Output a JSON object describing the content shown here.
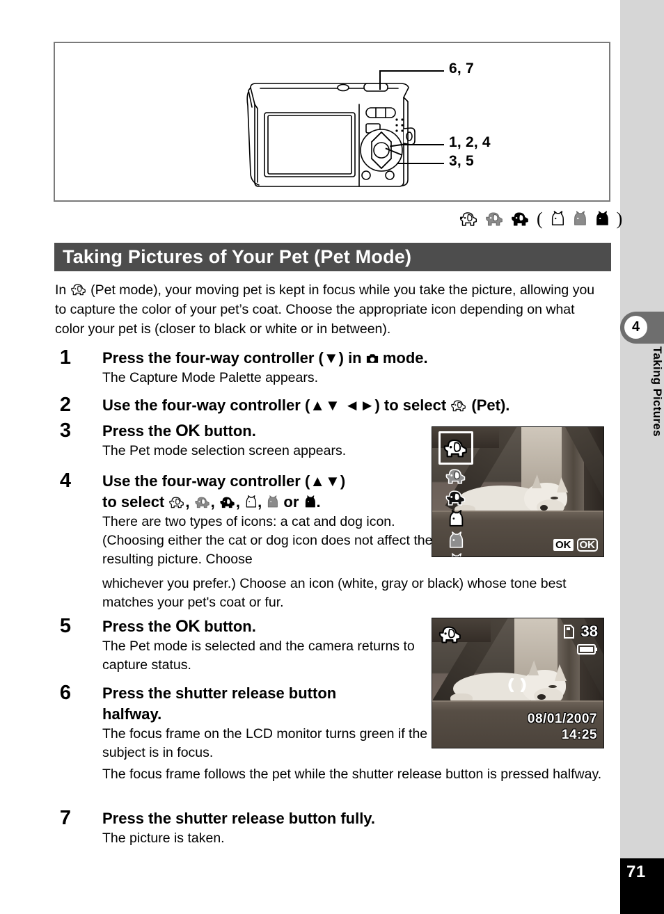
{
  "sidebar": {
    "chapter_number": "4",
    "chapter_title": "Taking Pictures",
    "page_number": "71"
  },
  "figure": {
    "callouts": [
      {
        "id": "callout-67",
        "label": "6, 7"
      },
      {
        "id": "callout-124",
        "label": "1, 2, 4"
      },
      {
        "id": "callout-35",
        "label": "3, 5"
      }
    ],
    "pet_icons": [
      {
        "name": "dog-white-icon",
        "tone": "white"
      },
      {
        "name": "dog-gray-icon",
        "tone": "gray"
      },
      {
        "name": "dog-black-icon",
        "tone": "black"
      },
      {
        "name": "paren-open",
        "tone": "text",
        "label": "("
      },
      {
        "name": "cat-white-icon",
        "tone": "white"
      },
      {
        "name": "cat-gray-icon",
        "tone": "gray"
      },
      {
        "name": "cat-black-icon",
        "tone": "black"
      },
      {
        "name": "paren-close",
        "tone": "text",
        "label": ")"
      }
    ],
    "paren_open": "(",
    "paren_close": ")"
  },
  "section": {
    "title": "Taking Pictures of Your Pet (Pet Mode)"
  },
  "intro": {
    "before_icon": "In ",
    "after_icon": " (Pet mode), your moving pet is kept in focus while you take the picture, allowing you to capture the color of your pet’s coat. Choose the appropriate icon depending on what color your pet is (closer to black or white or in between)."
  },
  "steps": [
    {
      "number": "1",
      "head_a": "Press the four-way controller (▼) in ",
      "head_b": " mode.",
      "body": "The Capture Mode Palette appears."
    },
    {
      "number": "2",
      "head_a": "Use the four-way controller (▲▼ ◄►) to select ",
      "head_b": " (Pet).",
      "body": ""
    },
    {
      "number": "3",
      "head_a": "Press the ",
      "head_ok": "OK",
      "head_b": " button.",
      "body": "The Pet mode selection screen appears."
    },
    {
      "number": "4",
      "head_a": "Use the four-way controller (▲▼)",
      "head_line2_a": "to select ",
      "head_sep": ", ",
      "head_or": " or ",
      "head_end": ".",
      "body": "There are two types of icons: a cat and dog icon. (Choosing either the cat or dog icon does not affect the resulting picture. Choose",
      "body_extra": "whichever you prefer.) Choose an icon (white, gray or black) whose tone best matches your pet's coat or fur."
    },
    {
      "number": "5",
      "head_a": "Press the ",
      "head_ok": "OK",
      "head_b": " button.",
      "body": "The Pet mode is selected and the camera returns to capture status."
    },
    {
      "number": "6",
      "head_a": "Press the shutter release button",
      "head_line2": "halfway.",
      "body": "The focus frame on the LCD monitor turns green if the subject is in focus.",
      "body_extra": "The focus frame follows the pet while the shutter release button is pressed halfway."
    },
    {
      "number": "7",
      "head_a": "Press the shutter release button fully.",
      "body": "The picture is taken."
    }
  ],
  "lcd_select": {
    "ok_key_label": "OK",
    "ok_round_label": "OK",
    "icons": [
      {
        "name": "dog-white-icon",
        "selected": true
      },
      {
        "name": "dog-gray-icon",
        "selected": false
      },
      {
        "name": "dog-black-icon",
        "selected": false
      },
      {
        "name": "cat-white-icon",
        "selected": false
      },
      {
        "name": "cat-gray-icon",
        "selected": false
      },
      {
        "name": "cat-black-icon",
        "selected": false
      }
    ]
  },
  "lcd_capture": {
    "mode_icon": "dog-white-icon",
    "frames_remaining": "38",
    "card_icon": "sd-card-icon",
    "battery_icon": "battery-full-icon",
    "focus_frame_icon": "focus-frame-icon",
    "date": "08/01/2007",
    "time": "14:25"
  },
  "colors": {
    "title_bar": "#4d4d4d",
    "rail": "#d6d6d6",
    "tab": "#6e6e6e",
    "page_block": "#000000",
    "figure_border": "#7a7a7a"
  }
}
